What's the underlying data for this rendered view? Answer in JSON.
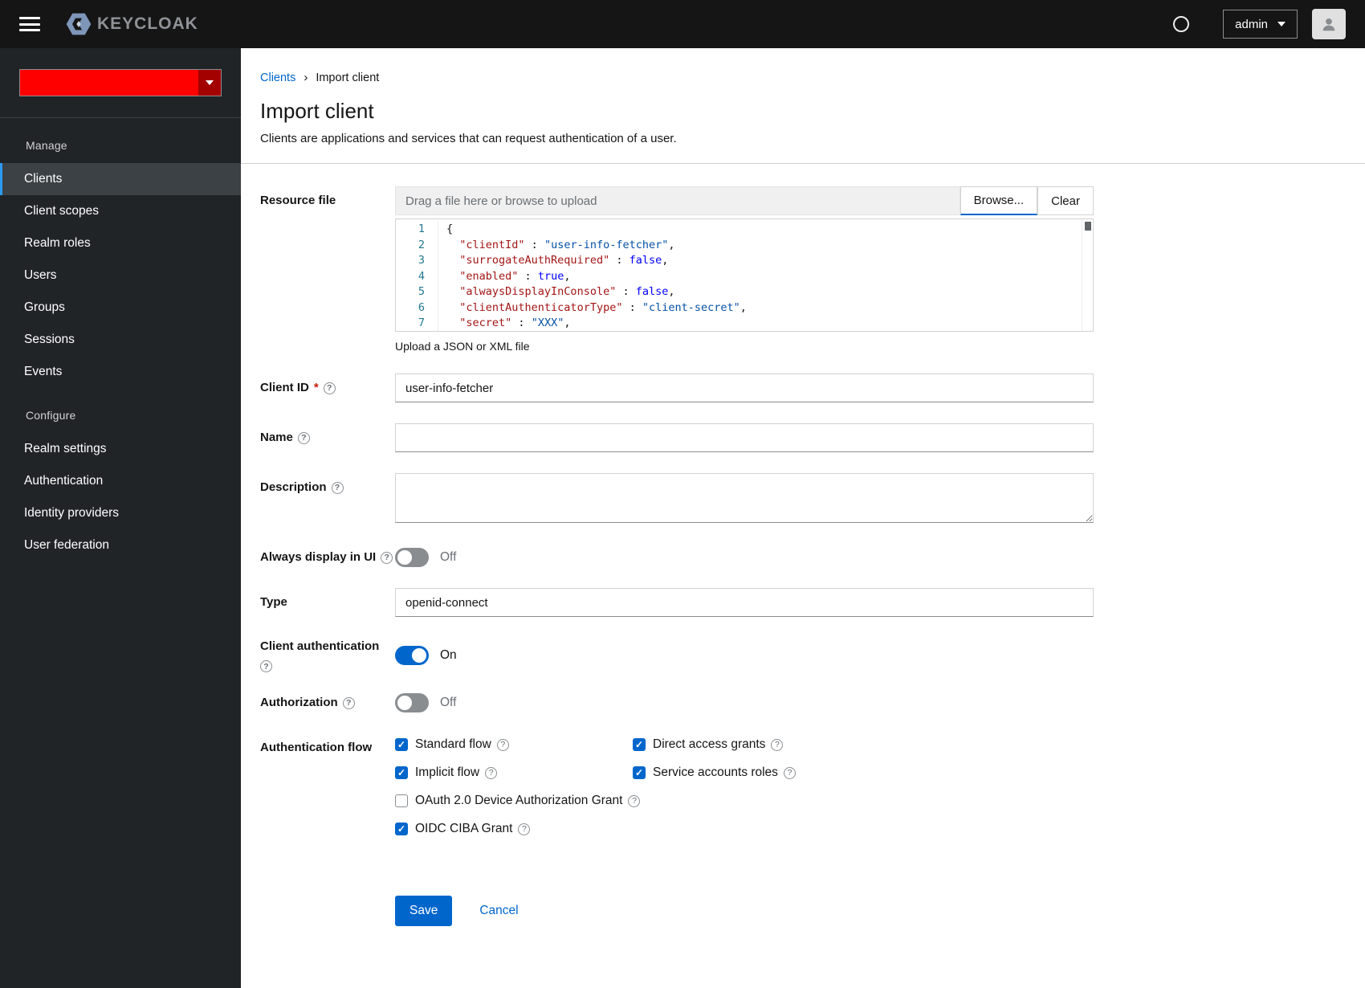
{
  "topbar": {
    "brand": "KEYCLOAK",
    "user_menu": "admin"
  },
  "sidebar": {
    "realm_selector": {
      "redacted": true,
      "color": "#ff0000"
    },
    "manage": {
      "header": "Manage",
      "items": [
        "Clients",
        "Client scopes",
        "Realm roles",
        "Users",
        "Groups",
        "Sessions",
        "Events"
      ]
    },
    "configure": {
      "header": "Configure",
      "items": [
        "Realm settings",
        "Authentication",
        "Identity providers",
        "User federation"
      ]
    },
    "selected": "Clients"
  },
  "breadcrumb": {
    "clients": "Clients",
    "current": "Import client"
  },
  "page": {
    "title": "Import client",
    "subtitle": "Clients are applications and services that can request authentication of a user."
  },
  "form": {
    "resource_file": {
      "label": "Resource file",
      "placeholder": "Drag a file here or browse to upload",
      "browse": "Browse...",
      "clear": "Clear",
      "helper": "Upload a JSON or XML file",
      "code_lines": [
        {
          "num": "1",
          "tokens": [
            {
              "c": "p",
              "t": "{"
            }
          ]
        },
        {
          "num": "2",
          "tokens": [
            {
              "c": "p",
              "t": "  "
            },
            {
              "c": "k",
              "t": "\"clientId\""
            },
            {
              "c": "p",
              "t": " : "
            },
            {
              "c": "s",
              "t": "\"user-info-fetcher\""
            },
            {
              "c": "p",
              "t": ","
            }
          ]
        },
        {
          "num": "3",
          "tokens": [
            {
              "c": "p",
              "t": "  "
            },
            {
              "c": "k",
              "t": "\"surrogateAuthRequired\""
            },
            {
              "c": "p",
              "t": " : "
            },
            {
              "c": "b",
              "t": "false"
            },
            {
              "c": "p",
              "t": ","
            }
          ]
        },
        {
          "num": "4",
          "tokens": [
            {
              "c": "p",
              "t": "  "
            },
            {
              "c": "k",
              "t": "\"enabled\""
            },
            {
              "c": "p",
              "t": " : "
            },
            {
              "c": "b",
              "t": "true"
            },
            {
              "c": "p",
              "t": ","
            }
          ]
        },
        {
          "num": "5",
          "tokens": [
            {
              "c": "p",
              "t": "  "
            },
            {
              "c": "k",
              "t": "\"alwaysDisplayInConsole\""
            },
            {
              "c": "p",
              "t": " : "
            },
            {
              "c": "b",
              "t": "false"
            },
            {
              "c": "p",
              "t": ","
            }
          ]
        },
        {
          "num": "6",
          "tokens": [
            {
              "c": "p",
              "t": "  "
            },
            {
              "c": "k",
              "t": "\"clientAuthenticatorType\""
            },
            {
              "c": "p",
              "t": " : "
            },
            {
              "c": "s",
              "t": "\"client-secret\""
            },
            {
              "c": "p",
              "t": ","
            }
          ]
        },
        {
          "num": "7",
          "tokens": [
            {
              "c": "p",
              "t": "  "
            },
            {
              "c": "k",
              "t": "\"secret\""
            },
            {
              "c": "p",
              "t": " : "
            },
            {
              "c": "s",
              "t": "\"XXX\""
            },
            {
              "c": "p",
              "t": ","
            }
          ]
        }
      ]
    },
    "client_id": {
      "label": "Client ID",
      "required": "*",
      "value": "user-info-fetcher"
    },
    "name": {
      "label": "Name",
      "value": ""
    },
    "description": {
      "label": "Description",
      "value": ""
    },
    "always_display": {
      "label": "Always display in UI",
      "state": "Off"
    },
    "type": {
      "label": "Type",
      "value": "openid-connect"
    },
    "client_auth": {
      "label": "Client authentication",
      "state": "On"
    },
    "authorization": {
      "label": "Authorization",
      "state": "Off"
    },
    "auth_flow": {
      "label": "Authentication flow",
      "options": [
        {
          "label": "Standard flow",
          "checked": true,
          "row": 1,
          "col": 1
        },
        {
          "label": "Direct access grants",
          "checked": true,
          "row": 1,
          "col": 2
        },
        {
          "label": "Implicit flow",
          "checked": true,
          "row": 2,
          "col": 1
        },
        {
          "label": "Service accounts roles",
          "checked": true,
          "row": 2,
          "col": 2
        },
        {
          "label": "OAuth 2.0 Device Authorization Grant",
          "checked": false,
          "row": 3,
          "col": 1
        },
        {
          "label": "OIDC CIBA Grant",
          "checked": true,
          "row": 4,
          "col": 1
        }
      ]
    },
    "actions": {
      "save": "Save",
      "cancel": "Cancel"
    }
  },
  "colors": {
    "accent": "#0066cc",
    "nav_active": "#2b9af3",
    "realm_redaction": "#ff0000"
  }
}
